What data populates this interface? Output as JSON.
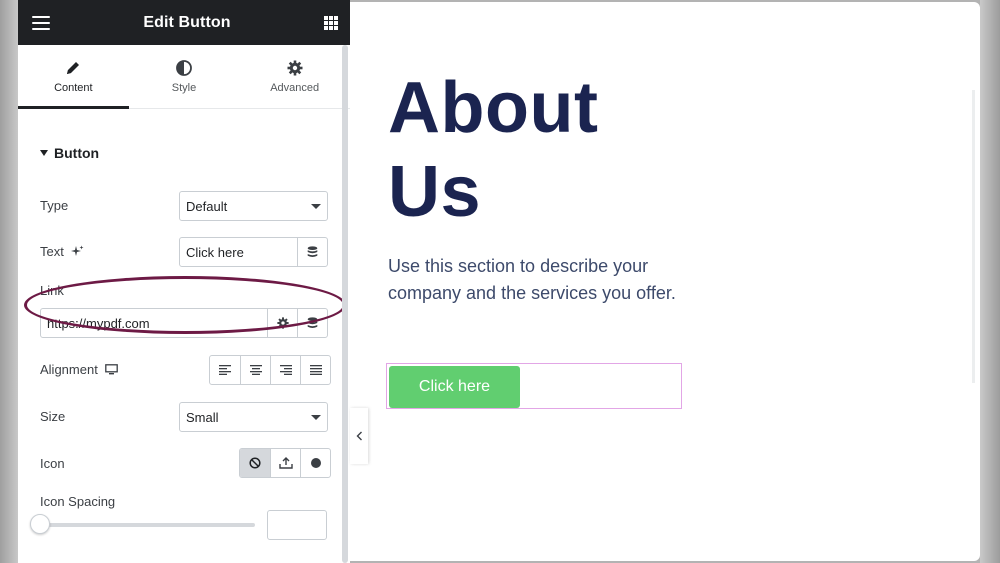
{
  "panel": {
    "title": "Edit Button",
    "tabs": [
      {
        "label": "Content",
        "icon": "pencil-icon",
        "active": true
      },
      {
        "label": "Style",
        "icon": "contrast-icon",
        "active": false
      },
      {
        "label": "Advanced",
        "icon": "gear-icon",
        "active": false
      }
    ],
    "section": "Button",
    "type": {
      "label": "Type",
      "value": "Default"
    },
    "text": {
      "label": "Text",
      "value": "Click here"
    },
    "link": {
      "label": "Link",
      "value": "https://mypdf.com"
    },
    "alignment": {
      "label": "Alignment"
    },
    "size": {
      "label": "Size",
      "value": "Small"
    },
    "icon": {
      "label": "Icon",
      "selected": "none"
    },
    "icon_spacing": {
      "label": "Icon Spacing",
      "value": ""
    }
  },
  "canvas": {
    "heading": "About Us",
    "description": "Use this section to describe your company and the services you offer.",
    "button_label": "Click here"
  },
  "colors": {
    "panel_header": "#1f2124",
    "heading": "#1b2450",
    "cta": "#61ce70",
    "highlight_oval": "#6d1a45",
    "button_outline": "#e2a6e6"
  }
}
